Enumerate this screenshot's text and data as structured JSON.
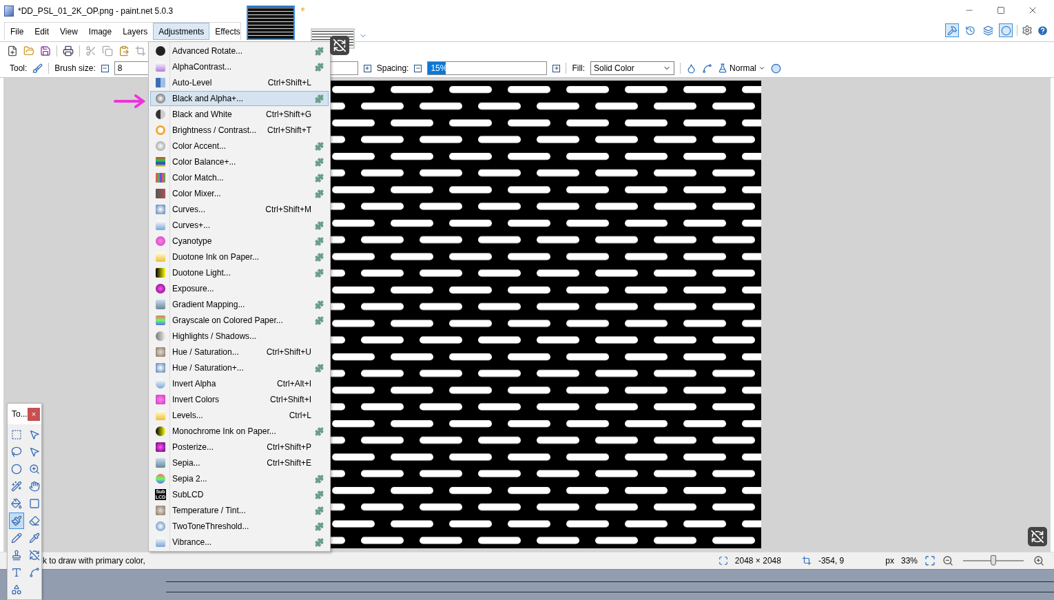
{
  "window": {
    "title": "*DD_PSL_01_2K_OP.png - paint.net 5.0.3"
  },
  "image_tabs": [
    {
      "selected": true,
      "modified": true
    },
    {
      "selected": false,
      "modified": false
    }
  ],
  "menu": [
    {
      "label": "File",
      "selected": false
    },
    {
      "label": "Edit",
      "selected": false
    },
    {
      "label": "View",
      "selected": false
    },
    {
      "label": "Image",
      "selected": false
    },
    {
      "label": "Layers",
      "selected": false
    },
    {
      "label": "Adjustments",
      "selected": true
    },
    {
      "label": "Effects",
      "selected": false
    }
  ],
  "side_panels": [
    {
      "selected": true
    },
    {
      "selected": false
    },
    {
      "selected": false
    },
    {
      "selected": true
    }
  ],
  "tool_options": {
    "tool_label": "Tool:",
    "brush_size_label": "Brush size:",
    "brush_size": "8",
    "spacing_label": "Spacing:",
    "spacing": {
      "value": "15%",
      "level": 0.15
    },
    "fill_label": "Fill:",
    "fill": "Solid Color",
    "blend_mode": "Normal"
  },
  "adjustments_menu": [
    {
      "label": "Advanced Rotate...",
      "plugin": true,
      "selected": false
    },
    {
      "label": "AlphaContrast...",
      "plugin": true,
      "selected": false
    },
    {
      "label": "Auto-Level",
      "shortcut": "Ctrl+Shift+L",
      "selected": false
    },
    {
      "label": "Black and Alpha+...",
      "plugin": true,
      "selected": true
    },
    {
      "label": "Black and White",
      "shortcut": "Ctrl+Shift+G",
      "selected": false
    },
    {
      "label": "Brightness / Contrast...",
      "shortcut": "Ctrl+Shift+T",
      "selected": false
    },
    {
      "label": "Color Accent...",
      "plugin": true,
      "selected": false
    },
    {
      "label": "Color Balance+...",
      "plugin": true,
      "selected": false
    },
    {
      "label": "Color Match...",
      "plugin": true,
      "selected": false
    },
    {
      "label": "Color Mixer...",
      "plugin": true,
      "selected": false
    },
    {
      "label": "Curves...",
      "shortcut": "Ctrl+Shift+M",
      "selected": false
    },
    {
      "label": "Curves+...",
      "plugin": true,
      "selected": false
    },
    {
      "label": "Cyanotype",
      "plugin": true,
      "selected": false
    },
    {
      "label": "Duotone Ink on Paper...",
      "plugin": true,
      "selected": false
    },
    {
      "label": "Duotone Light...",
      "plugin": true,
      "selected": false
    },
    {
      "label": "Exposure...",
      "selected": false
    },
    {
      "label": "Gradient Mapping...",
      "plugin": true,
      "selected": false
    },
    {
      "label": "Grayscale on Colored Paper...",
      "plugin": true,
      "selected": false
    },
    {
      "label": "Highlights / Shadows...",
      "selected": false
    },
    {
      "label": "Hue / Saturation...",
      "shortcut": "Ctrl+Shift+U",
      "selected": false
    },
    {
      "label": "Hue / Saturation+...",
      "plugin": true,
      "selected": false
    },
    {
      "label": "Invert Alpha",
      "shortcut": "Ctrl+Alt+I",
      "selected": false
    },
    {
      "label": "Invert Colors",
      "shortcut": "Ctrl+Shift+I",
      "selected": false
    },
    {
      "label": "Levels...",
      "shortcut": "Ctrl+L",
      "selected": false
    },
    {
      "label": "Monochrome Ink on Paper...",
      "plugin": true,
      "selected": false
    },
    {
      "label": "Posterize...",
      "shortcut": "Ctrl+Shift+P",
      "selected": false
    },
    {
      "label": "Sepia...",
      "shortcut": "Ctrl+Shift+E",
      "selected": false
    },
    {
      "label": "Sepia 2...",
      "plugin": true,
      "selected": false
    },
    {
      "label": "SubLCD",
      "plugin": true,
      "icon_text": [
        "Sub",
        "LCD"
      ],
      "selected": false
    },
    {
      "label": "Temperature / Tint...",
      "plugin": true,
      "selected": false
    },
    {
      "label": "TwoToneThreshold...",
      "plugin": true,
      "selected": false
    },
    {
      "label": "Vibrance...",
      "plugin": true,
      "selected": false
    }
  ],
  "status_bar": {
    "hint": "k to draw with primary color,",
    "size": "2048 × 2048",
    "cursor": "-354, 9",
    "units": "px",
    "zoom": "33%",
    "zoom_slider": {
      "level": 0.5
    }
  },
  "tools_window": {
    "title": "To...",
    "close": "×",
    "tools": [
      {
        "selected": false
      },
      {
        "selected": false
      },
      {
        "selected": false
      },
      {
        "selected": false
      },
      {
        "selected": false
      },
      {
        "selected": false
      },
      {
        "selected": false
      },
      {
        "selected": false
      },
      {
        "selected": false
      },
      {
        "selected": false
      },
      {
        "selected": true
      },
      {
        "selected": false
      },
      {
        "selected": false
      },
      {
        "selected": false
      },
      {
        "selected": false
      },
      {
        "selected": false
      },
      {
        "selected": false
      },
      {
        "selected": false
      },
      {
        "selected": false
      }
    ]
  }
}
